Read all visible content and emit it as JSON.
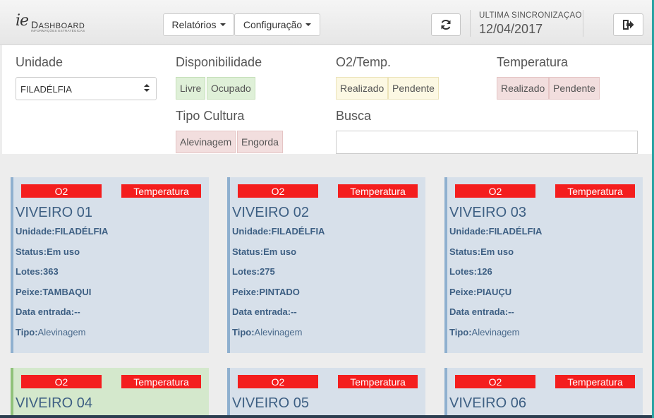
{
  "header": {
    "logo_ie": "ie",
    "logo_dashboard_first": "D",
    "logo_dashboard_rest": "ASHBOARD",
    "logo_subtitle": "INFORMAÇÕES ESTRATÉGICAS",
    "menu_relatorios": "Relatórios",
    "menu_configuracao": "Configuração",
    "refresh_icon": "refresh-icon",
    "sync_label": "ULTIMA SINCRONIZAÇAO",
    "sync_date": "12/04/2017",
    "logout_icon": "sign-out-icon"
  },
  "filters": {
    "unidade_label": "Unidade",
    "unidade_value": "FILADÉLFIA",
    "disponibilidade_label": "Disponibilidade",
    "disponibilidade_options": [
      "Livre",
      "Ocupado"
    ],
    "o2temp_label": "O2/Temp.",
    "o2temp_options": [
      "Realizado",
      "Pendente"
    ],
    "temperatura_label": "Temperatura",
    "temperatura_options": [
      "Realizado",
      "Pendente"
    ],
    "tipo_label": "Tipo Cultura",
    "tipo_options": [
      "Alevinagem",
      "Engorda"
    ],
    "busca_label": "Busca",
    "busca_value": ""
  },
  "card_labels": {
    "o2": "O2",
    "temp": "Temperatura",
    "unidade": "Unidade:",
    "status": "Status:",
    "lotes": "Lotes:",
    "peixe": "Peixe:",
    "data": "Data entrada:",
    "tipo": "Tipo:"
  },
  "cards": [
    {
      "name": "VIVEIRO 01",
      "unidade": "FILADÉLFIA",
      "status": "Em uso",
      "lotes": "363",
      "peixe": "TAMBAQUI",
      "data": "--",
      "tipo": "Alevinagem"
    },
    {
      "name": "VIVEIRO 02",
      "unidade": "FILADÉLFIA",
      "status": "Em uso",
      "lotes": "275",
      "peixe": "PINTADO",
      "data": "--",
      "tipo": "Alevinagem"
    },
    {
      "name": "VIVEIRO 03",
      "unidade": "FILADÉLFIA",
      "status": "Em uso",
      "lotes": "126",
      "peixe": "PIAUÇU",
      "data": "--",
      "tipo": "Alevinagem"
    },
    {
      "name": "VIVEIRO 04"
    },
    {
      "name": "VIVEIRO 05"
    },
    {
      "name": "VIVEIRO 06"
    }
  ],
  "colors": {
    "badge_red": "#f41e1e",
    "card_blue": "#d7e0ea",
    "card_green": "#d4e8cc",
    "text_blue": "#3d5f83"
  }
}
